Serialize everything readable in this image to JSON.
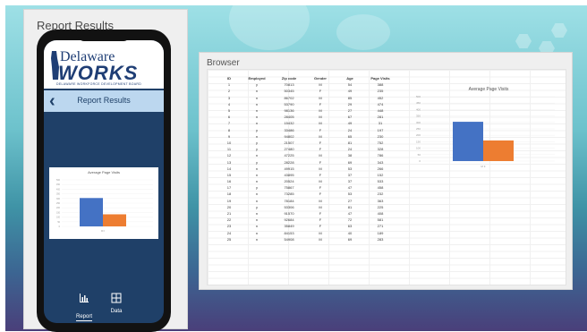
{
  "colors": {
    "navy": "#1f4068",
    "navbar_bg": "#bcd7ef",
    "bar_blue": "#4472c4",
    "bar_orange": "#ed7d31"
  },
  "phone_panel": {
    "title": "Report Results",
    "logo": {
      "line1": "Delaware",
      "line2": "WORKS",
      "tagline": "DELAWARE WORKFORCE DEVELOPMENT BOARD"
    },
    "nav": {
      "back_icon": "chevron-left-icon",
      "title": "Report Results"
    },
    "tabs": [
      {
        "label": "Report",
        "icon": "bar-chart-icon",
        "active": true
      },
      {
        "label": "Data",
        "icon": "grid-icon",
        "active": false
      }
    ]
  },
  "browser": {
    "title": "Browser",
    "table": {
      "columns": [
        "ID",
        "Employed",
        "Zip code",
        "Gender",
        "Age",
        "Page Visits"
      ],
      "rows": [
        [
          "1",
          "y",
          "70813",
          "M",
          "54",
          "388"
        ],
        [
          "2",
          "n",
          "50345",
          "F",
          "49",
          "235"
        ],
        [
          "3",
          "n",
          "86702",
          "M",
          "85",
          "452"
        ],
        [
          "4",
          "n",
          "53790",
          "F",
          "29",
          "474"
        ],
        [
          "5",
          "n",
          "98136",
          "M",
          "27",
          "448"
        ],
        [
          "6",
          "n",
          "28405",
          "M",
          "67",
          "281"
        ],
        [
          "7",
          "n",
          "15432",
          "M",
          "49",
          "31"
        ],
        [
          "8",
          "y",
          "33486",
          "F",
          "24",
          "197"
        ],
        [
          "9",
          "n",
          "94802",
          "M",
          "65",
          "230"
        ],
        [
          "10",
          "y",
          "21507",
          "F",
          "81",
          "752"
        ],
        [
          "11",
          "y",
          "27480",
          "F",
          "24",
          "328"
        ],
        [
          "12",
          "n",
          "47225",
          "M",
          "38",
          "786"
        ],
        [
          "13",
          "y",
          "28228",
          "F",
          "69",
          "343"
        ],
        [
          "14",
          "n",
          "49915",
          "M",
          "53",
          "266"
        ],
        [
          "15",
          "n",
          "43895",
          "F",
          "37",
          "152"
        ],
        [
          "16",
          "n",
          "20524",
          "M",
          "37",
          "533"
        ],
        [
          "17",
          "y",
          "75867",
          "F",
          "47",
          "458"
        ],
        [
          "18",
          "n",
          "73285",
          "F",
          "53",
          "232"
        ],
        [
          "19",
          "n",
          "78184",
          "M",
          "27",
          "363"
        ],
        [
          "20",
          "y",
          "53306",
          "M",
          "81",
          "225"
        ],
        [
          "21",
          "n",
          "91570",
          "F",
          "47",
          "408"
        ],
        [
          "22",
          "n",
          "92684",
          "F",
          "72",
          "581"
        ],
        [
          "23",
          "n",
          "35849",
          "F",
          "63",
          "271"
        ],
        [
          "24",
          "n",
          "84153",
          "M",
          "40",
          "189"
        ],
        [
          "25",
          "n",
          "54908",
          "M",
          "69",
          "283"
        ]
      ]
    }
  },
  "chart_data": [
    {
      "type": "bar",
      "title": "Average Page Visits",
      "categories": [
        "M",
        "F"
      ],
      "series": [
        {
          "values": [
            305,
            160
          ]
        }
      ],
      "ylim": [
        0,
        500
      ],
      "xlabel": "M   F",
      "grid": true,
      "legend": "none"
    },
    {
      "type": "bar",
      "title": "Average Page Visits",
      "categories": [
        "M",
        "F"
      ],
      "series": [
        {
          "values": [
            305,
            130
          ]
        }
      ],
      "ylim": [
        0,
        500
      ],
      "xlabel": "M   F",
      "grid": true,
      "legend": "none"
    }
  ]
}
